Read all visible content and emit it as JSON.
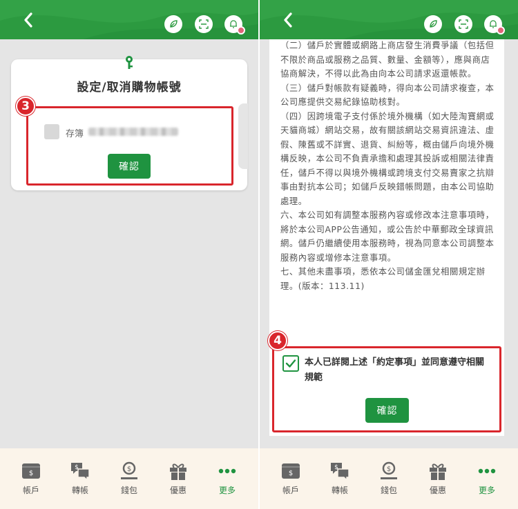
{
  "left": {
    "title": "設定/取消購物帳號",
    "step_badge": "3",
    "account_label": "存簿",
    "confirm_label": "確認"
  },
  "right": {
    "terms": [
      "（二）儲戶於實體或網路上商店發生消費爭議（包括但不限於商品或服務之品質、數量、金額等），應與商店協商解決，不得以此為由向本公司請求返還帳款。",
      "（三）儲戶對帳款有疑義時，得向本公司請求複查，本公司應提供交易紀錄協助核對。",
      "（四）因跨境電子支付係於境外機構（如大陸淘寶網或天貓商城）網站交易，故有關該網站交易資訊違法、虛假、陳舊或不詳實、退貨、糾紛等，概由儲戶向境外機構反映，本公司不負責承擔和處理其投訴或相關法律責任，儲戶不得以與境外機構或跨境支付交易賣家之抗辯事由對抗本公司；如儲戶反映錯帳問題，由本公司協助處理。",
      "六、本公司如有調整本服務內容或修改本注意事項時，將於本公司APP公告通知，或公告於中華郵政全球資訊網。儲戶仍繼續使用本服務時，視為同意本公司調整本服務內容或增修本注意事項。",
      "七、其他未盡事項，悉依本公司儲金匯兌相關規定辦理。(版本：113.11)"
    ],
    "step_badge": "4",
    "agree_text": "本人已詳閱上述「約定事項」並同意遵守相關規範",
    "confirm_label": "確認"
  },
  "nav": {
    "items": [
      {
        "label": "帳戶",
        "icon": "account-icon"
      },
      {
        "label": "轉帳",
        "icon": "transfer-icon"
      },
      {
        "label": "錢包",
        "icon": "wallet-icon"
      },
      {
        "label": "優惠",
        "icon": "gift-icon"
      },
      {
        "label": "更多",
        "icon": "more-icon"
      }
    ],
    "active_index": 4
  },
  "colors": {
    "header_green": "#2c9a40",
    "button_green": "#1f9340",
    "highlight_red": "#d9262c",
    "nav_bg": "#fbf4ea"
  }
}
